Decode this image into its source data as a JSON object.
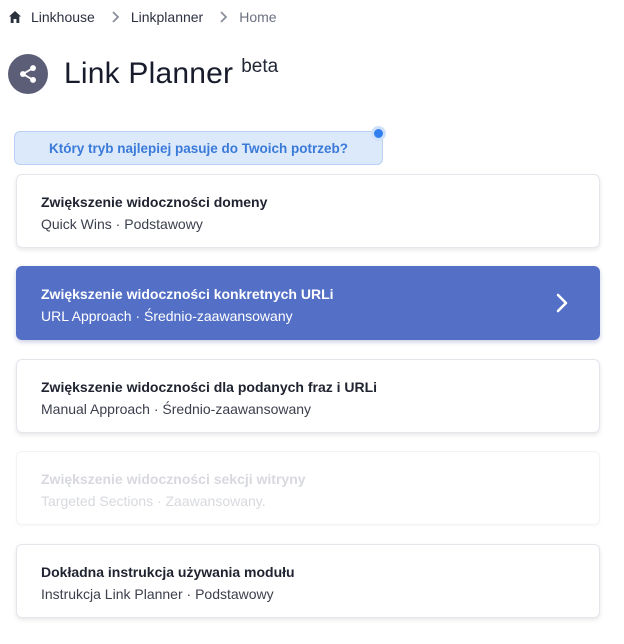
{
  "breadcrumb": {
    "items": [
      "Linkhouse",
      "Linkplanner",
      "Home"
    ]
  },
  "header": {
    "title": "Link Planner",
    "badge": "beta"
  },
  "question": "Który tryb najlepiej pasuje do Twoich potrzeb?",
  "options": [
    {
      "title": "Zwiększenie widoczności domeny",
      "subtitle": "Quick Wins · Podstawowy",
      "state": "normal"
    },
    {
      "title": "Zwiększenie widoczności konkretnych URLi",
      "subtitle": "URL Approach · Średnio-zaawansowany",
      "state": "selected"
    },
    {
      "title": "Zwiększenie widoczności dla podanych fraz i URLi",
      "subtitle": "Manual Approach · Średnio-zaawansowany",
      "state": "normal"
    },
    {
      "title": "Zwiększenie widoczności sekcji witryny",
      "subtitle": "Targeted Sections · Zaawansowany.",
      "state": "disabled"
    },
    {
      "title": "Dokładna instrukcja używania modułu",
      "subtitle": "Instrukcja Link Planner · Podstawowy",
      "state": "normal"
    }
  ],
  "colors": {
    "accent": "#5470c6",
    "question_bg": "#dce9fb",
    "question_text": "#3a7ad8",
    "badge_bg": "#5c5e77"
  },
  "icons": {
    "home": "home-icon",
    "separator": "chevron-right-icon",
    "share": "share-icon",
    "selected_arrow": "chevron-right-icon"
  }
}
